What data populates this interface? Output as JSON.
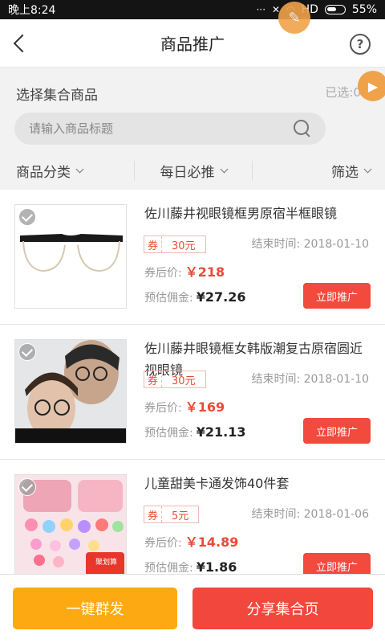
{
  "status_bar": {
    "time": "晚上8:24",
    "network": "HD",
    "battery": "55%"
  },
  "header": {
    "title": "商品推广",
    "help": "?"
  },
  "filter": {
    "select_label": "选择集合商品",
    "selected_count": "已选:0",
    "search_placeholder": "请输入商品标题",
    "tabs": [
      {
        "label": "商品分类"
      },
      {
        "label": "每日必推"
      },
      {
        "label": "筛选"
      }
    ]
  },
  "products": [
    {
      "title": "佐川藤井视眼镜框男原宿半框眼镜",
      "coupon_tag": "券",
      "coupon_value": "30元",
      "end_time": "结束时间: 2018-01-10",
      "price_label": "券后价:",
      "price": "￥218",
      "commission_label": "预估佣金:",
      "commission": "¥27.26",
      "button": "立即推广"
    },
    {
      "title": "佐川藤井眼镜框女韩版潮复古原宿圆近视眼镜",
      "coupon_tag": "券",
      "coupon_value": "30元",
      "end_time": "结束时间: 2018-01-10",
      "price_label": "券后价:",
      "price": "￥169",
      "commission_label": "预估佣金:",
      "commission": "¥21.13",
      "button": "立即推广"
    },
    {
      "title": "儿童甜美卡通发饰40件套",
      "coupon_tag": "券",
      "coupon_value": "5元",
      "end_time": "结束时间: 2018-01-06",
      "price_label": "券后价:",
      "price": "￥14.89",
      "commission_label": "预估佣金:",
      "commission": "¥1.86",
      "button": "立即推广",
      "image_badge": "聚划算"
    }
  ],
  "bottom": {
    "mass_send": "一键群发",
    "share_page": "分享集合页"
  },
  "colors": {
    "accent_red": "#f24a3d",
    "accent_orange": "#fdaa12",
    "bubble": "#f0a24a"
  }
}
